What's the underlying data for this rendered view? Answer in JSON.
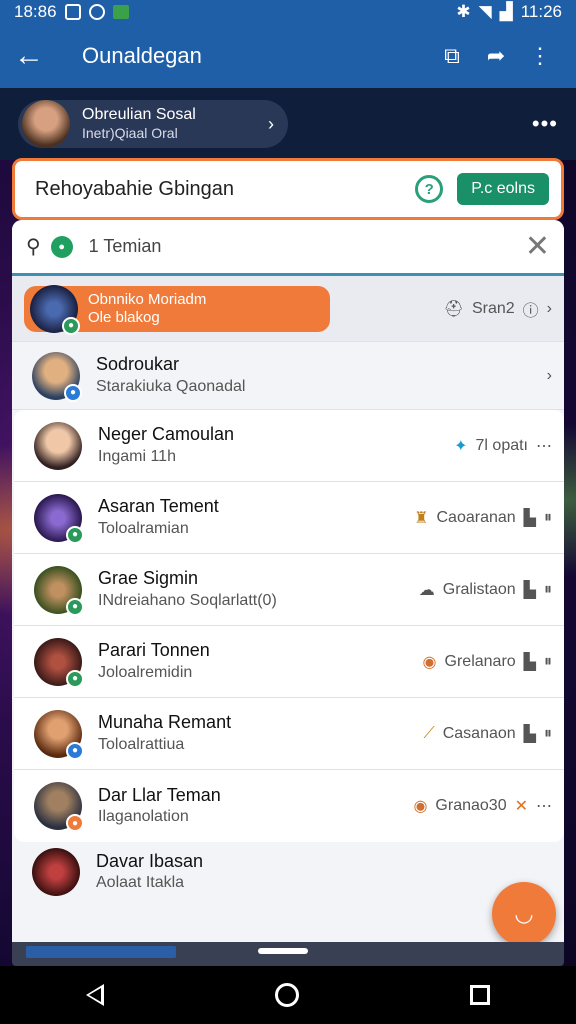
{
  "status_bar": {
    "time_left": "18:86",
    "time_right": "11:26"
  },
  "app_bar": {
    "title": "Ounaldegan"
  },
  "profile": {
    "name": "Obreulian Sosal",
    "subtitle": "Inetr)Qiaal Oral"
  },
  "search_card": {
    "text": "Rehoyabahie Gbingan",
    "button_label": "P.c eolns"
  },
  "filter": {
    "count_label": "1 Temian"
  },
  "highlight": {
    "name": "Obnniko Moriadm",
    "status": "Ole blakog",
    "meta": "Sran2"
  },
  "contacts": [
    {
      "name": "Sodroukar",
      "status": "Starakiuka Qaonadal",
      "meta": ""
    },
    {
      "name": "Neger Camoulan",
      "status": "Ingami 11h",
      "meta": "7l opatı"
    },
    {
      "name": "Asaran Tement",
      "status": "Toloalramian",
      "meta": "Caoaranan"
    },
    {
      "name": "Grae Sigmin",
      "status": "INdreiahano Soqlarlatt(0)",
      "meta": "Gralistaon"
    },
    {
      "name": "Parari Tonnen",
      "status": "Joloalremidin",
      "meta": "Grelanaro"
    },
    {
      "name": "Munaha Remant",
      "status": "Toloalrattiua",
      "meta": "Casanaon"
    },
    {
      "name": "Dar Llar Teman",
      "status": "Ilaganolation",
      "meta": "Granao30"
    },
    {
      "name": "Davar Ibasan",
      "status": "Aolaat Itakla",
      "meta": ""
    }
  ],
  "colors": {
    "appbar": "#1e5fa8",
    "accent": "#f07a3a",
    "primary_button": "#1a9068",
    "underline": "#3c90b8"
  }
}
